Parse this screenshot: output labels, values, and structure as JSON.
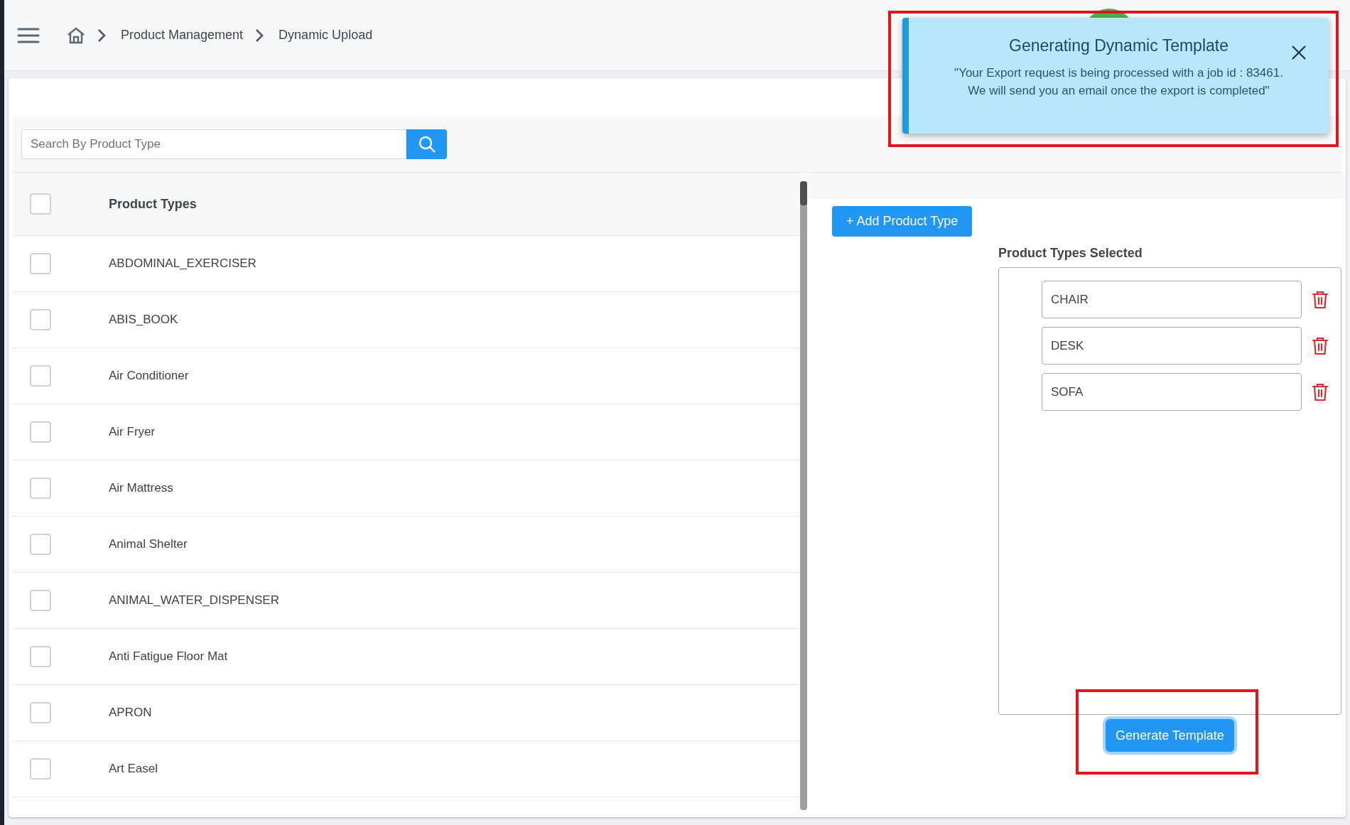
{
  "breadcrumb": [
    {
      "label": "Product Management"
    },
    {
      "label": "Dynamic Upload"
    }
  ],
  "search": {
    "placeholder": "Search By Product Type"
  },
  "table": {
    "header": {
      "label": "Product Types",
      "checked": false
    },
    "rows": [
      {
        "label": "ABDOMINAL_EXERCISER",
        "checked": false
      },
      {
        "label": "ABIS_BOOK",
        "checked": false
      },
      {
        "label": "Air Conditioner",
        "checked": false
      },
      {
        "label": "Air Fryer",
        "checked": false
      },
      {
        "label": "Air Mattress",
        "checked": false
      },
      {
        "label": "Animal Shelter",
        "checked": false
      },
      {
        "label": "ANIMAL_WATER_DISPENSER",
        "checked": false
      },
      {
        "label": "Anti Fatigue Floor Mat",
        "checked": false
      },
      {
        "label": "APRON",
        "checked": false
      },
      {
        "label": "Art Easel",
        "checked": false
      }
    ]
  },
  "add_button": "+ Add Product Type",
  "selected_panel": {
    "title": "Product Types Selected",
    "items": [
      "CHAIR",
      "DESK",
      "SOFA"
    ]
  },
  "generate_button": "Generate Template",
  "toast": {
    "title": "Generating Dynamic Template",
    "lines": [
      "\"Your Export request is being processed with a job id : 83461.",
      "We will send you an email once the export is completed\""
    ]
  }
}
